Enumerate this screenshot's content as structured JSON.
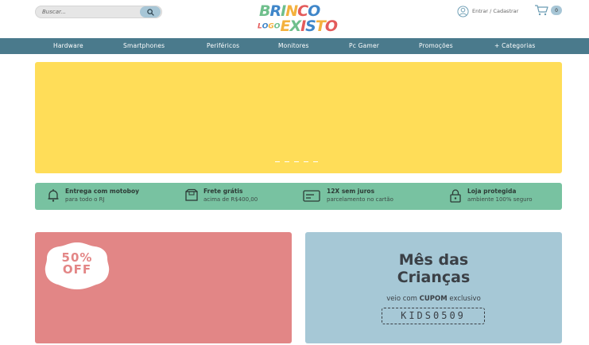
{
  "header": {
    "search": {
      "placeholder": "Buscar..."
    },
    "logo": {
      "line1": "BRINCO",
      "line2_small": "LOGO",
      "line2": "EXISTO"
    },
    "account": {
      "label": "Entrar / Cadastrar"
    },
    "cart": {
      "count": "0"
    }
  },
  "nav": {
    "items": [
      {
        "label": "Hardware"
      },
      {
        "label": "Smartphones"
      },
      {
        "label": "Periféricos"
      },
      {
        "label": "Monitores"
      },
      {
        "label": "Pc Gamer"
      },
      {
        "label": "Promoções"
      },
      {
        "label": "+ Categorias"
      }
    ]
  },
  "banner": {
    "color": "#ffdd58",
    "slides": 4,
    "active_slide": 1
  },
  "benefits": [
    {
      "icon": "bell-icon",
      "title": "Entrega com motoboy",
      "subtitle": "para todo o RJ"
    },
    {
      "icon": "box-icon",
      "title": "Frete grátis",
      "subtitle": "acima de R$400,00"
    },
    {
      "icon": "card-icon",
      "title": "12X sem juros",
      "subtitle": "parcelamento no cartão"
    },
    {
      "icon": "lock-icon",
      "title": "Loja protegida",
      "subtitle": "ambiente 100% seguro"
    }
  ],
  "promo_left": {
    "badge_line1": "50%",
    "badge_line2": "OFF",
    "color": "#e28686"
  },
  "promo_right": {
    "title_line1": "Mês das",
    "title_line2": "Crianças",
    "subtitle_prefix": "veio com",
    "subtitle_bold": "CUPOM",
    "subtitle_suffix": "exclusivo",
    "coupon_code": "KIDS0509",
    "color": "#a6c8d6"
  },
  "colors": {
    "nav": "#4a7a8c",
    "benefits": "#78c2a1",
    "accent": "#a7c6d6"
  }
}
